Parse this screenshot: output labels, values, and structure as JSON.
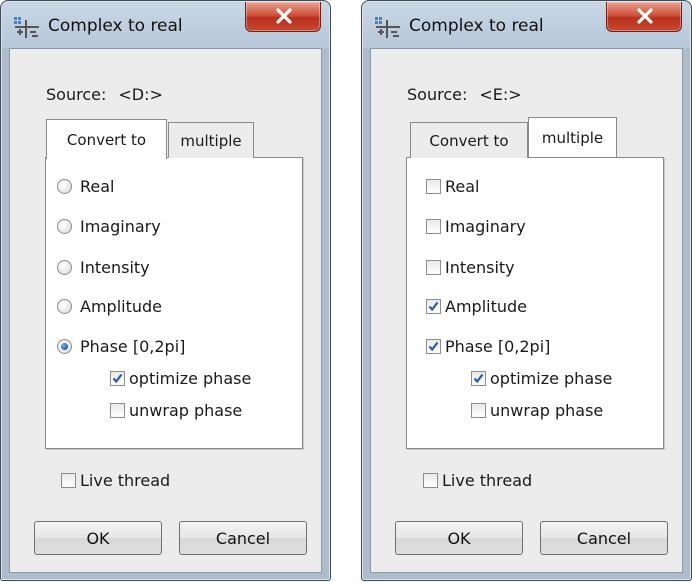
{
  "dialogs": [
    {
      "title": "Complex to real",
      "source_label": "Source:",
      "source_value": "<D:>",
      "tabs": [
        "Convert to",
        "multiple"
      ],
      "active_tab": "Convert to",
      "control_type": "radio",
      "options": [
        {
          "label": "Real",
          "checked": false
        },
        {
          "label": "Imaginary",
          "checked": false
        },
        {
          "label": "Intensity",
          "checked": false
        },
        {
          "label": "Amplitude",
          "checked": false
        },
        {
          "label": "Phase [0,2pi]",
          "checked": true
        }
      ],
      "sub_options": [
        {
          "label": "optimize phase",
          "checked": true
        },
        {
          "label": "unwrap phase",
          "checked": false
        }
      ],
      "live_thread": {
        "label": "Live thread",
        "checked": false
      },
      "ok_label": "OK",
      "cancel_label": "Cancel"
    },
    {
      "title": "Complex to real",
      "source_label": "Source:",
      "source_value": "<E:>",
      "tabs": [
        "Convert to",
        "multiple"
      ],
      "active_tab": "multiple",
      "control_type": "checkbox",
      "options": [
        {
          "label": "Real",
          "checked": false
        },
        {
          "label": "Imaginary",
          "checked": false
        },
        {
          "label": "Intensity",
          "checked": false
        },
        {
          "label": "Amplitude",
          "checked": true
        },
        {
          "label": "Phase [0,2pi]",
          "checked": true
        }
      ],
      "sub_options": [
        {
          "label": "optimize phase",
          "checked": true
        },
        {
          "label": "unwrap phase",
          "checked": false
        }
      ],
      "live_thread": {
        "label": "Live thread",
        "checked": false
      },
      "ok_label": "OK",
      "cancel_label": "Cancel"
    }
  ],
  "icons": {
    "app": "complex-to-real-icon",
    "close": "close-icon"
  },
  "colors": {
    "frame": "#aebdcc",
    "close_button": "#c8482f",
    "radio_selected": "#1c5fb4",
    "checkmark": "#2b5aa8"
  }
}
